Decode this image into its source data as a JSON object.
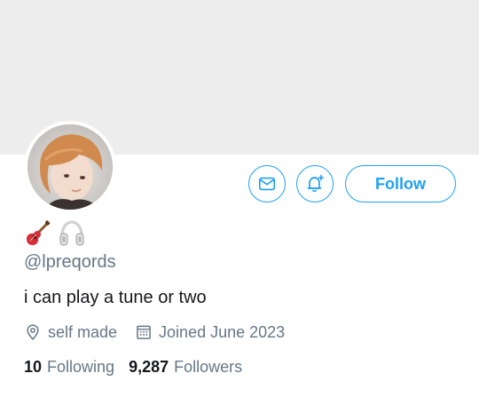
{
  "profile": {
    "handle": "@lpreqords",
    "bio": "i can play a tune or two",
    "emojis": [
      "guitar-icon",
      "headphones-icon"
    ],
    "location": "self made",
    "joined": "Joined June 2023"
  },
  "actions": {
    "message_icon": "mail-icon",
    "notify_icon": "bell-plus-icon",
    "follow_label": "Follow"
  },
  "stats": {
    "following_count": "10",
    "following_label": "Following",
    "followers_count": "9,287",
    "followers_label": "Followers"
  },
  "colors": {
    "accent": "#1da1f2",
    "banner": "#ededed",
    "secondary_text": "#657786",
    "primary_text": "#14171a"
  }
}
